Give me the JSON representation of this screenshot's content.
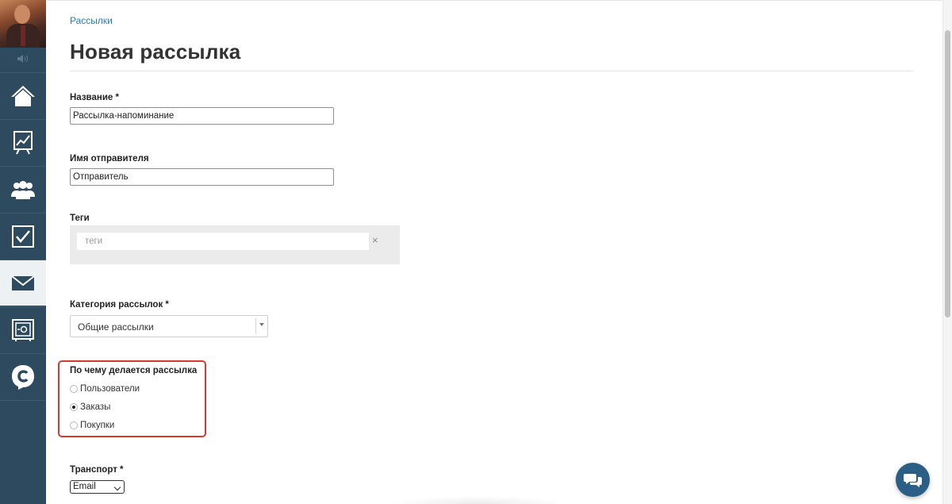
{
  "breadcrumb": "Рассылки",
  "page_title": "Новая рассылка",
  "form": {
    "name": {
      "label": "Название *",
      "value": "Рассылка-напоминание"
    },
    "sender": {
      "label": "Имя отправителя",
      "value": "Отправитель"
    },
    "tags": {
      "label": "Теги",
      "placeholder": "теги",
      "clear_icon": "×"
    },
    "category": {
      "label": "Категория рассылок *",
      "value": "Общие рассылки"
    },
    "basis": {
      "label": "По чему делается рассылка",
      "options": [
        {
          "label": "Пользователи",
          "checked": false
        },
        {
          "label": "Заказы",
          "checked": true
        },
        {
          "label": "Покупки",
          "checked": false
        }
      ]
    },
    "transport": {
      "label": "Транспорт *",
      "value": "Email"
    }
  },
  "sidebar": {
    "items": [
      {
        "icon": "home-icon",
        "active": false
      },
      {
        "icon": "chart-icon",
        "active": false
      },
      {
        "icon": "users-icon",
        "active": false
      },
      {
        "icon": "tasks-icon",
        "active": false
      },
      {
        "icon": "mail-icon",
        "active": true
      },
      {
        "icon": "safe-icon",
        "active": false
      },
      {
        "icon": "brand-c-icon",
        "active": false
      }
    ]
  },
  "colors": {
    "sidebar_bg": "#2e4a5e",
    "link": "#2a7ab8",
    "highlight_border": "#d83a33",
    "chat_button": "#2c5f85"
  }
}
